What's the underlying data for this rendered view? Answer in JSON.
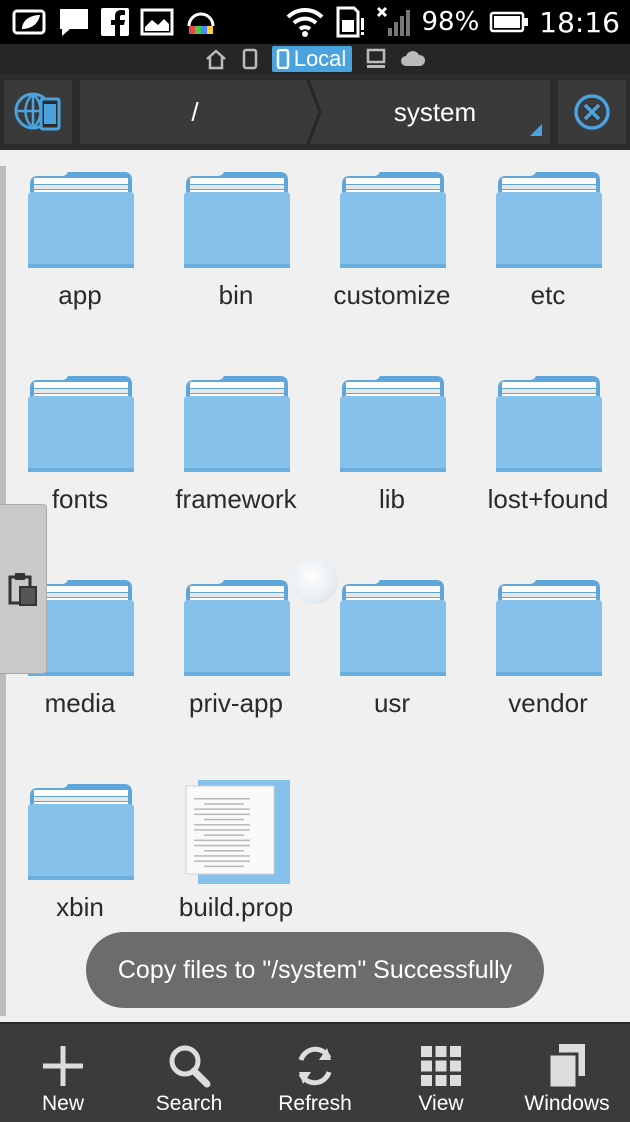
{
  "status_bar": {
    "battery": "98%",
    "time": "18:16"
  },
  "location_strip": {
    "active_label": "Local"
  },
  "path_bar": {
    "root_label": "/",
    "current_label": "system"
  },
  "files": [
    {
      "name": "app",
      "type": "folder"
    },
    {
      "name": "bin",
      "type": "folder"
    },
    {
      "name": "customize",
      "type": "folder"
    },
    {
      "name": "etc",
      "type": "folder"
    },
    {
      "name": "fonts",
      "type": "folder"
    },
    {
      "name": "framework",
      "type": "folder"
    },
    {
      "name": "lib",
      "type": "folder"
    },
    {
      "name": "lost+found",
      "type": "folder"
    },
    {
      "name": "media",
      "type": "folder"
    },
    {
      "name": "priv-app",
      "type": "folder"
    },
    {
      "name": "usr",
      "type": "folder"
    },
    {
      "name": "vendor",
      "type": "folder"
    },
    {
      "name": "xbin",
      "type": "folder"
    },
    {
      "name": "build.prop",
      "type": "file"
    }
  ],
  "toast": {
    "message": "Copy files to \"/system\" Successfully"
  },
  "bottom_bar": {
    "items": [
      {
        "label": "New",
        "icon": "plus-icon"
      },
      {
        "label": "Search",
        "icon": "search-icon"
      },
      {
        "label": "Refresh",
        "icon": "refresh-icon"
      },
      {
        "label": "View",
        "icon": "grid-view-icon"
      },
      {
        "label": "Windows",
        "icon": "windows-stack-icon"
      }
    ]
  },
  "colors": {
    "accent": "#4aa3df",
    "folder": "#7fbde9",
    "bar": "#3b3b3b"
  }
}
